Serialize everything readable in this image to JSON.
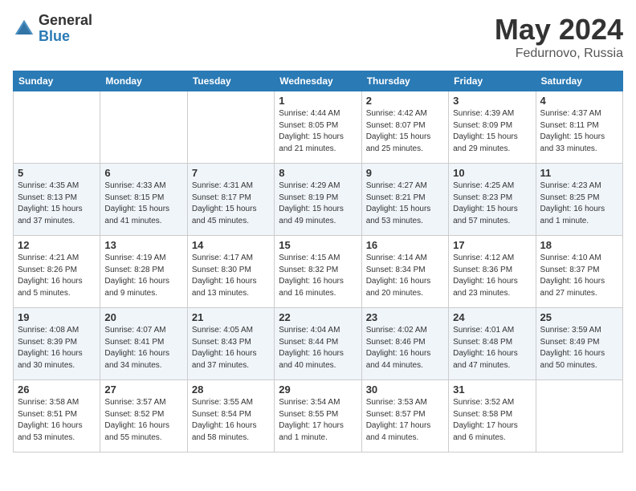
{
  "header": {
    "logo_general": "General",
    "logo_blue": "Blue",
    "title": "May 2024",
    "location": "Fedurnovo, Russia"
  },
  "days_of_week": [
    "Sunday",
    "Monday",
    "Tuesday",
    "Wednesday",
    "Thursday",
    "Friday",
    "Saturday"
  ],
  "weeks": [
    {
      "row_class": "row-odd",
      "days": [
        {
          "num": "",
          "info": "",
          "empty": true
        },
        {
          "num": "",
          "info": "",
          "empty": true
        },
        {
          "num": "",
          "info": "",
          "empty": true
        },
        {
          "num": "1",
          "info": "Sunrise: 4:44 AM\nSunset: 8:05 PM\nDaylight: 15 hours\nand 21 minutes.",
          "empty": false
        },
        {
          "num": "2",
          "info": "Sunrise: 4:42 AM\nSunset: 8:07 PM\nDaylight: 15 hours\nand 25 minutes.",
          "empty": false
        },
        {
          "num": "3",
          "info": "Sunrise: 4:39 AM\nSunset: 8:09 PM\nDaylight: 15 hours\nand 29 minutes.",
          "empty": false
        },
        {
          "num": "4",
          "info": "Sunrise: 4:37 AM\nSunset: 8:11 PM\nDaylight: 15 hours\nand 33 minutes.",
          "empty": false
        }
      ]
    },
    {
      "row_class": "row-even",
      "days": [
        {
          "num": "5",
          "info": "Sunrise: 4:35 AM\nSunset: 8:13 PM\nDaylight: 15 hours\nand 37 minutes.",
          "empty": false
        },
        {
          "num": "6",
          "info": "Sunrise: 4:33 AM\nSunset: 8:15 PM\nDaylight: 15 hours\nand 41 minutes.",
          "empty": false
        },
        {
          "num": "7",
          "info": "Sunrise: 4:31 AM\nSunset: 8:17 PM\nDaylight: 15 hours\nand 45 minutes.",
          "empty": false
        },
        {
          "num": "8",
          "info": "Sunrise: 4:29 AM\nSunset: 8:19 PM\nDaylight: 15 hours\nand 49 minutes.",
          "empty": false
        },
        {
          "num": "9",
          "info": "Sunrise: 4:27 AM\nSunset: 8:21 PM\nDaylight: 15 hours\nand 53 minutes.",
          "empty": false
        },
        {
          "num": "10",
          "info": "Sunrise: 4:25 AM\nSunset: 8:23 PM\nDaylight: 15 hours\nand 57 minutes.",
          "empty": false
        },
        {
          "num": "11",
          "info": "Sunrise: 4:23 AM\nSunset: 8:25 PM\nDaylight: 16 hours\nand 1 minute.",
          "empty": false
        }
      ]
    },
    {
      "row_class": "row-odd",
      "days": [
        {
          "num": "12",
          "info": "Sunrise: 4:21 AM\nSunset: 8:26 PM\nDaylight: 16 hours\nand 5 minutes.",
          "empty": false
        },
        {
          "num": "13",
          "info": "Sunrise: 4:19 AM\nSunset: 8:28 PM\nDaylight: 16 hours\nand 9 minutes.",
          "empty": false
        },
        {
          "num": "14",
          "info": "Sunrise: 4:17 AM\nSunset: 8:30 PM\nDaylight: 16 hours\nand 13 minutes.",
          "empty": false
        },
        {
          "num": "15",
          "info": "Sunrise: 4:15 AM\nSunset: 8:32 PM\nDaylight: 16 hours\nand 16 minutes.",
          "empty": false
        },
        {
          "num": "16",
          "info": "Sunrise: 4:14 AM\nSunset: 8:34 PM\nDaylight: 16 hours\nand 20 minutes.",
          "empty": false
        },
        {
          "num": "17",
          "info": "Sunrise: 4:12 AM\nSunset: 8:36 PM\nDaylight: 16 hours\nand 23 minutes.",
          "empty": false
        },
        {
          "num": "18",
          "info": "Sunrise: 4:10 AM\nSunset: 8:37 PM\nDaylight: 16 hours\nand 27 minutes.",
          "empty": false
        }
      ]
    },
    {
      "row_class": "row-even",
      "days": [
        {
          "num": "19",
          "info": "Sunrise: 4:08 AM\nSunset: 8:39 PM\nDaylight: 16 hours\nand 30 minutes.",
          "empty": false
        },
        {
          "num": "20",
          "info": "Sunrise: 4:07 AM\nSunset: 8:41 PM\nDaylight: 16 hours\nand 34 minutes.",
          "empty": false
        },
        {
          "num": "21",
          "info": "Sunrise: 4:05 AM\nSunset: 8:43 PM\nDaylight: 16 hours\nand 37 minutes.",
          "empty": false
        },
        {
          "num": "22",
          "info": "Sunrise: 4:04 AM\nSunset: 8:44 PM\nDaylight: 16 hours\nand 40 minutes.",
          "empty": false
        },
        {
          "num": "23",
          "info": "Sunrise: 4:02 AM\nSunset: 8:46 PM\nDaylight: 16 hours\nand 44 minutes.",
          "empty": false
        },
        {
          "num": "24",
          "info": "Sunrise: 4:01 AM\nSunset: 8:48 PM\nDaylight: 16 hours\nand 47 minutes.",
          "empty": false
        },
        {
          "num": "25",
          "info": "Sunrise: 3:59 AM\nSunset: 8:49 PM\nDaylight: 16 hours\nand 50 minutes.",
          "empty": false
        }
      ]
    },
    {
      "row_class": "row-odd",
      "days": [
        {
          "num": "26",
          "info": "Sunrise: 3:58 AM\nSunset: 8:51 PM\nDaylight: 16 hours\nand 53 minutes.",
          "empty": false
        },
        {
          "num": "27",
          "info": "Sunrise: 3:57 AM\nSunset: 8:52 PM\nDaylight: 16 hours\nand 55 minutes.",
          "empty": false
        },
        {
          "num": "28",
          "info": "Sunrise: 3:55 AM\nSunset: 8:54 PM\nDaylight: 16 hours\nand 58 minutes.",
          "empty": false
        },
        {
          "num": "29",
          "info": "Sunrise: 3:54 AM\nSunset: 8:55 PM\nDaylight: 17 hours\nand 1 minute.",
          "empty": false
        },
        {
          "num": "30",
          "info": "Sunrise: 3:53 AM\nSunset: 8:57 PM\nDaylight: 17 hours\nand 4 minutes.",
          "empty": false
        },
        {
          "num": "31",
          "info": "Sunrise: 3:52 AM\nSunset: 8:58 PM\nDaylight: 17 hours\nand 6 minutes.",
          "empty": false
        },
        {
          "num": "",
          "info": "",
          "empty": true
        }
      ]
    }
  ]
}
